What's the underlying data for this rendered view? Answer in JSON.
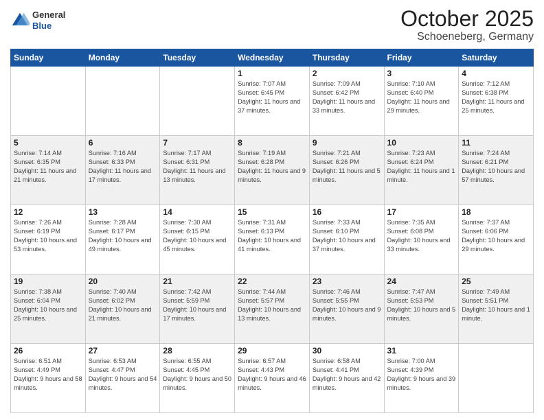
{
  "header": {
    "logo": {
      "general": "General",
      "blue": "Blue"
    },
    "title": "October 2025",
    "subtitle": "Schoeneberg, Germany"
  },
  "weekdays": [
    "Sunday",
    "Monday",
    "Tuesday",
    "Wednesday",
    "Thursday",
    "Friday",
    "Saturday"
  ],
  "weeks": [
    [
      {
        "day": "",
        "sunrise": "",
        "sunset": "",
        "daylight": ""
      },
      {
        "day": "",
        "sunrise": "",
        "sunset": "",
        "daylight": ""
      },
      {
        "day": "",
        "sunrise": "",
        "sunset": "",
        "daylight": ""
      },
      {
        "day": "1",
        "sunrise": "Sunrise: 7:07 AM",
        "sunset": "Sunset: 6:45 PM",
        "daylight": "Daylight: 11 hours and 37 minutes."
      },
      {
        "day": "2",
        "sunrise": "Sunrise: 7:09 AM",
        "sunset": "Sunset: 6:42 PM",
        "daylight": "Daylight: 11 hours and 33 minutes."
      },
      {
        "day": "3",
        "sunrise": "Sunrise: 7:10 AM",
        "sunset": "Sunset: 6:40 PM",
        "daylight": "Daylight: 11 hours and 29 minutes."
      },
      {
        "day": "4",
        "sunrise": "Sunrise: 7:12 AM",
        "sunset": "Sunset: 6:38 PM",
        "daylight": "Daylight: 11 hours and 25 minutes."
      }
    ],
    [
      {
        "day": "5",
        "sunrise": "Sunrise: 7:14 AM",
        "sunset": "Sunset: 6:35 PM",
        "daylight": "Daylight: 11 hours and 21 minutes."
      },
      {
        "day": "6",
        "sunrise": "Sunrise: 7:16 AM",
        "sunset": "Sunset: 6:33 PM",
        "daylight": "Daylight: 11 hours and 17 minutes."
      },
      {
        "day": "7",
        "sunrise": "Sunrise: 7:17 AM",
        "sunset": "Sunset: 6:31 PM",
        "daylight": "Daylight: 11 hours and 13 minutes."
      },
      {
        "day": "8",
        "sunrise": "Sunrise: 7:19 AM",
        "sunset": "Sunset: 6:28 PM",
        "daylight": "Daylight: 11 hours and 9 minutes."
      },
      {
        "day": "9",
        "sunrise": "Sunrise: 7:21 AM",
        "sunset": "Sunset: 6:26 PM",
        "daylight": "Daylight: 11 hours and 5 minutes."
      },
      {
        "day": "10",
        "sunrise": "Sunrise: 7:23 AM",
        "sunset": "Sunset: 6:24 PM",
        "daylight": "Daylight: 11 hours and 1 minute."
      },
      {
        "day": "11",
        "sunrise": "Sunrise: 7:24 AM",
        "sunset": "Sunset: 6:21 PM",
        "daylight": "Daylight: 10 hours and 57 minutes."
      }
    ],
    [
      {
        "day": "12",
        "sunrise": "Sunrise: 7:26 AM",
        "sunset": "Sunset: 6:19 PM",
        "daylight": "Daylight: 10 hours and 53 minutes."
      },
      {
        "day": "13",
        "sunrise": "Sunrise: 7:28 AM",
        "sunset": "Sunset: 6:17 PM",
        "daylight": "Daylight: 10 hours and 49 minutes."
      },
      {
        "day": "14",
        "sunrise": "Sunrise: 7:30 AM",
        "sunset": "Sunset: 6:15 PM",
        "daylight": "Daylight: 10 hours and 45 minutes."
      },
      {
        "day": "15",
        "sunrise": "Sunrise: 7:31 AM",
        "sunset": "Sunset: 6:13 PM",
        "daylight": "Daylight: 10 hours and 41 minutes."
      },
      {
        "day": "16",
        "sunrise": "Sunrise: 7:33 AM",
        "sunset": "Sunset: 6:10 PM",
        "daylight": "Daylight: 10 hours and 37 minutes."
      },
      {
        "day": "17",
        "sunrise": "Sunrise: 7:35 AM",
        "sunset": "Sunset: 6:08 PM",
        "daylight": "Daylight: 10 hours and 33 minutes."
      },
      {
        "day": "18",
        "sunrise": "Sunrise: 7:37 AM",
        "sunset": "Sunset: 6:06 PM",
        "daylight": "Daylight: 10 hours and 29 minutes."
      }
    ],
    [
      {
        "day": "19",
        "sunrise": "Sunrise: 7:38 AM",
        "sunset": "Sunset: 6:04 PM",
        "daylight": "Daylight: 10 hours and 25 minutes."
      },
      {
        "day": "20",
        "sunrise": "Sunrise: 7:40 AM",
        "sunset": "Sunset: 6:02 PM",
        "daylight": "Daylight: 10 hours and 21 minutes."
      },
      {
        "day": "21",
        "sunrise": "Sunrise: 7:42 AM",
        "sunset": "Sunset: 5:59 PM",
        "daylight": "Daylight: 10 hours and 17 minutes."
      },
      {
        "day": "22",
        "sunrise": "Sunrise: 7:44 AM",
        "sunset": "Sunset: 5:57 PM",
        "daylight": "Daylight: 10 hours and 13 minutes."
      },
      {
        "day": "23",
        "sunrise": "Sunrise: 7:46 AM",
        "sunset": "Sunset: 5:55 PM",
        "daylight": "Daylight: 10 hours and 9 minutes."
      },
      {
        "day": "24",
        "sunrise": "Sunrise: 7:47 AM",
        "sunset": "Sunset: 5:53 PM",
        "daylight": "Daylight: 10 hours and 5 minutes."
      },
      {
        "day": "25",
        "sunrise": "Sunrise: 7:49 AM",
        "sunset": "Sunset: 5:51 PM",
        "daylight": "Daylight: 10 hours and 1 minute."
      }
    ],
    [
      {
        "day": "26",
        "sunrise": "Sunrise: 6:51 AM",
        "sunset": "Sunset: 4:49 PM",
        "daylight": "Daylight: 9 hours and 58 minutes."
      },
      {
        "day": "27",
        "sunrise": "Sunrise: 6:53 AM",
        "sunset": "Sunset: 4:47 PM",
        "daylight": "Daylight: 9 hours and 54 minutes."
      },
      {
        "day": "28",
        "sunrise": "Sunrise: 6:55 AM",
        "sunset": "Sunset: 4:45 PM",
        "daylight": "Daylight: 9 hours and 50 minutes."
      },
      {
        "day": "29",
        "sunrise": "Sunrise: 6:57 AM",
        "sunset": "Sunset: 4:43 PM",
        "daylight": "Daylight: 9 hours and 46 minutes."
      },
      {
        "day": "30",
        "sunrise": "Sunrise: 6:58 AM",
        "sunset": "Sunset: 4:41 PM",
        "daylight": "Daylight: 9 hours and 42 minutes."
      },
      {
        "day": "31",
        "sunrise": "Sunrise: 7:00 AM",
        "sunset": "Sunset: 4:39 PM",
        "daylight": "Daylight: 9 hours and 39 minutes."
      },
      {
        "day": "",
        "sunrise": "",
        "sunset": "",
        "daylight": ""
      }
    ]
  ]
}
